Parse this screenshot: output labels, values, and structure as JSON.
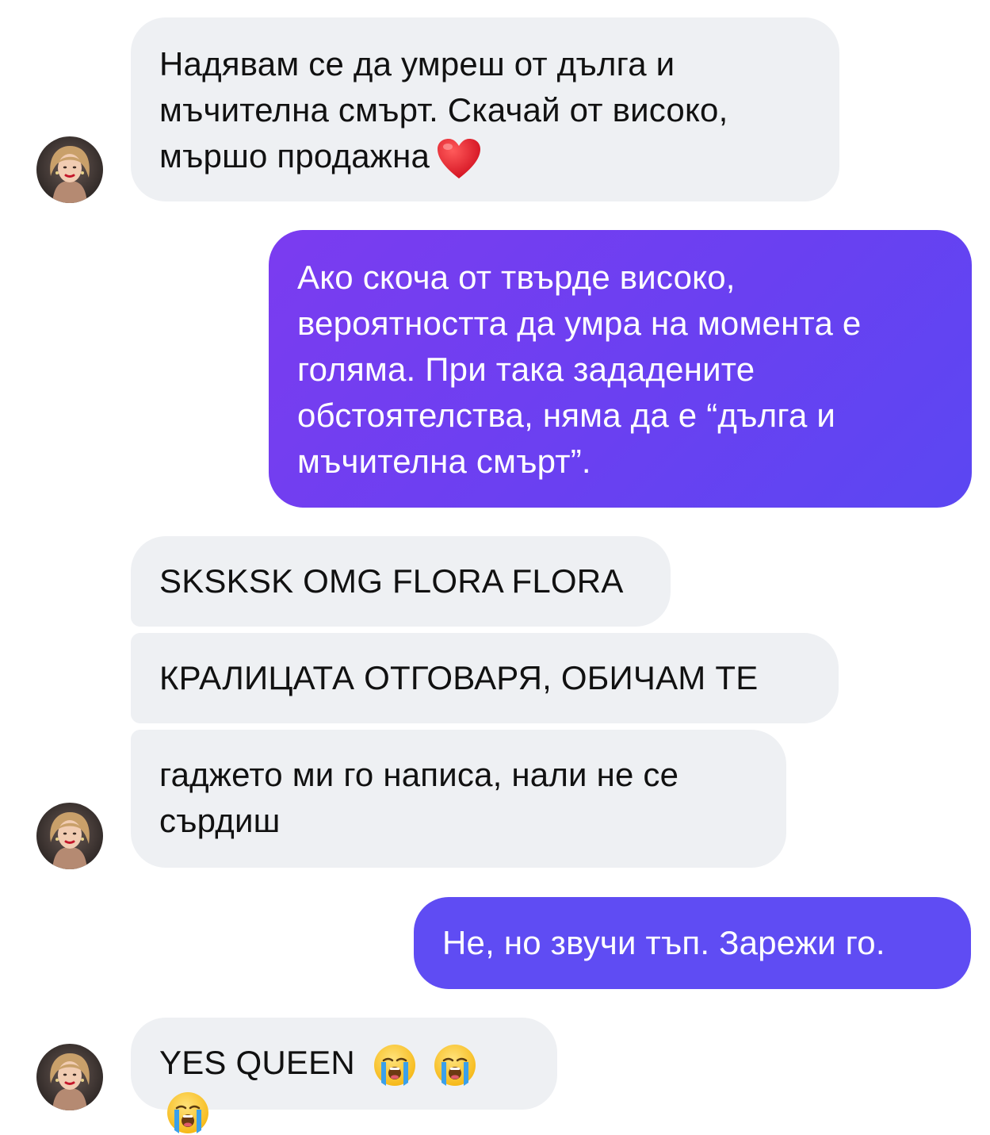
{
  "messages": {
    "m1": {
      "text": "Надявам се да умреш от дълга и мъчителна смърт. Скачай от високо, мършо продажна",
      "emoji": "red-heart"
    },
    "m2": {
      "text": "Ако скоча от твърде високо, вероятността да умра на момента е голяма. При така зададените обстоятелства, няма да е “дълга и мъчителна смърт”."
    },
    "m3": {
      "text": "SKSKSK OMG FLORA FLORA"
    },
    "m4": {
      "text": "КРАЛИЦАТА ОТГОВАРЯ, ОБИЧАМ ТЕ"
    },
    "m5": {
      "text": "гаджето ми го написа, нали не се сърдиш"
    },
    "m6": {
      "text": "Не, но звучи тъп. Зарежи го."
    },
    "m7": {
      "text": "YES QUEEN",
      "emoji": "loudly-crying-face"
    }
  },
  "colors": {
    "incoming_bubble": "#eef0f3",
    "outgoing_gradient_start": "#7b3cf0",
    "outgoing_gradient_end": "#5b47f2",
    "outgoing_solid": "#5f4cf3"
  }
}
